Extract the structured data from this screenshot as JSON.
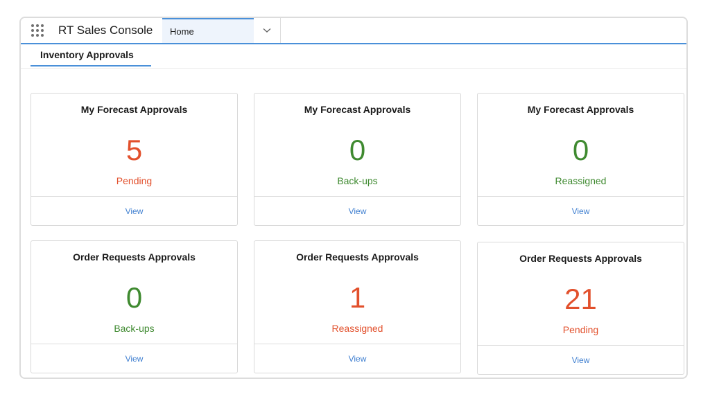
{
  "header": {
    "app_name": "RT Sales Console",
    "tabs": [
      {
        "label": "Home",
        "active": true
      }
    ]
  },
  "subtabs": [
    {
      "label": "Inventory Approvals",
      "active": true
    }
  ],
  "colors": {
    "pending_red": "#e2502c",
    "ok_green": "#3f8a30",
    "link_blue": "#3f7fd0",
    "accent_blue": "#4a90d9"
  },
  "cards": [
    {
      "title": "My Forecast Approvals",
      "count": "5",
      "status": "Pending",
      "link": "View",
      "tone": "red"
    },
    {
      "title": "My Forecast Approvals",
      "count": "0",
      "status": "Back-ups",
      "link": "View",
      "tone": "green"
    },
    {
      "title": "My Forecast Approvals",
      "count": "0",
      "status": "Reassigned",
      "link": "View",
      "tone": "green"
    },
    {
      "title": "Order Requests Approvals",
      "count": "0",
      "status": "Back-ups",
      "link": "View",
      "tone": "green"
    },
    {
      "title": "Order Requests Approvals",
      "count": "1",
      "status": "Reassigned",
      "link": "View",
      "tone": "red"
    },
    {
      "title": "Order Requests Approvals",
      "count": "21",
      "status": "Pending",
      "link": "View",
      "tone": "red"
    }
  ]
}
